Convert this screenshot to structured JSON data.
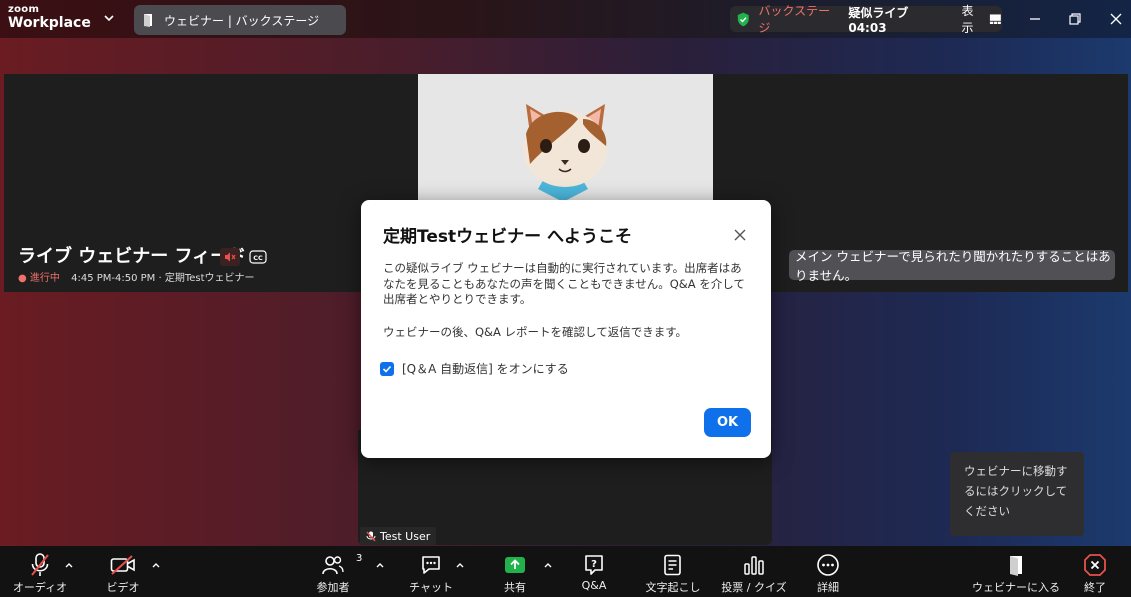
{
  "app": {
    "logo_top": "zoom",
    "logo_bottom": "Workplace"
  },
  "tab": {
    "label": "ウェビナー | バックステージ"
  },
  "status": {
    "backstage": "バックステージ",
    "simulive": "疑似ライブ 04:03",
    "view": "表示"
  },
  "feed": {
    "title": "ライブ ウェビナー フィード",
    "live": "進行中",
    "time": "4:45 PM-4:50 PM · 定期Testウェビナー"
  },
  "notice": {
    "text": "メイン ウェビナーで見られたり聞かれたりすることはありません。"
  },
  "dialog": {
    "title": "定期Testウェビナー へようこそ",
    "body1": "この疑似ライブ ウェビナーは自動的に実行されています。出席者はあなたを見ることもあなたの声を聞くこともできません。Q&A を介して出席者とやりとりできます。",
    "body2": "ウェビナーの後、Q&A レポートを確認して返信できます。",
    "checkbox_label": "[Q＆A 自動返信] をオンにする",
    "checkbox_checked": true,
    "ok": "OK"
  },
  "participant": {
    "name": "Test User"
  },
  "tooltip": {
    "text": "ウェビナーに移動するにはクリックしてください"
  },
  "toolbar": {
    "audio": "オーディオ",
    "video": "ビデオ",
    "participants": "参加者",
    "participants_count": "3",
    "chat": "チャット",
    "share": "共有",
    "qa": "Q&A",
    "captions": "文字起こし",
    "polls": "投票 / クイズ",
    "more": "詳細",
    "enter": "ウェビナーに入る",
    "end": "終了"
  },
  "colors": {
    "accent": "#0e71eb",
    "danger": "#e8504a",
    "share_green": "#22b24c"
  }
}
